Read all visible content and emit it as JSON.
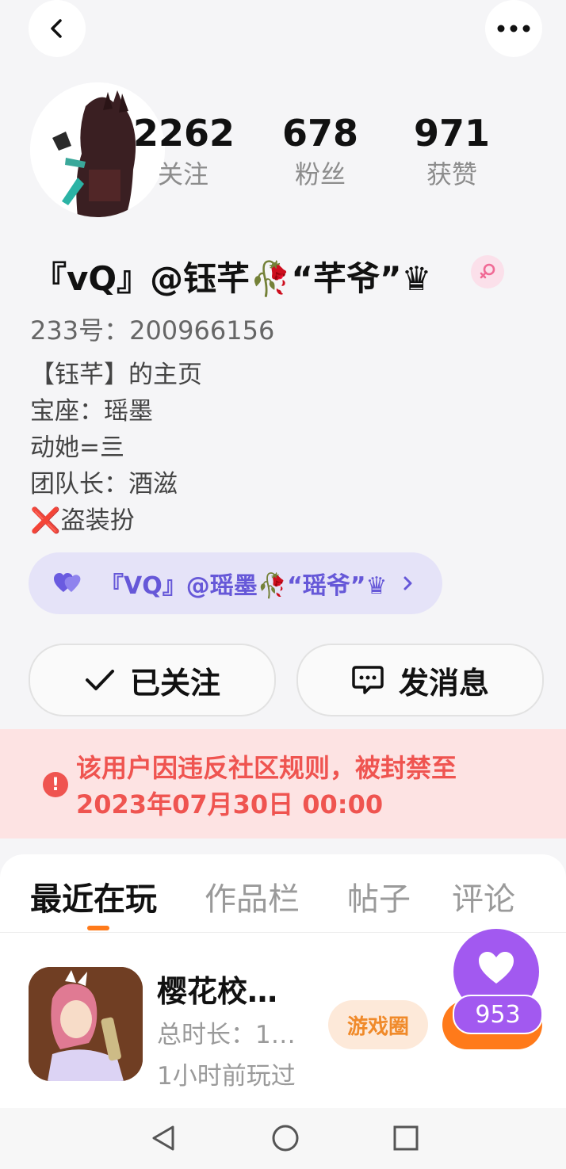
{
  "header": {
    "back_icon": "chevron-left-icon",
    "more_icon": "more-horizontal-icon"
  },
  "profile": {
    "stats": [
      {
        "value": "2262",
        "label": "关注"
      },
      {
        "value": "678",
        "label": "粉丝"
      },
      {
        "value": "971",
        "label": "获赞"
      }
    ],
    "nickname": "『vQ』@钰芊🥀“芊爷”♛",
    "gender_icon": "female-symbol-icon",
    "id_line": "233号：200966156",
    "bio": [
      "【钰芊】的主页",
      "宝座：瑶墨",
      "动她=亖",
      "团队长：酒滋",
      "❌盗装扮"
    ]
  },
  "cp": {
    "label": "『VQ』@瑶墨🥀“瑶爷”♛",
    "icon": "hearts-icon"
  },
  "actions": {
    "follow_label": "已关注",
    "message_label": "发消息"
  },
  "ban": {
    "line1": "该用户因违反社区规则，被封禁至",
    "line2": "2023年07月30日 00:00",
    "color": "#ef5450"
  },
  "tabs": [
    "最近在玩",
    "作品栏",
    "帖子",
    "评论"
  ],
  "game": {
    "title": "樱花校…",
    "duration": "总时长：1…",
    "last_played": "1小时前玩过",
    "circle_button": "游戏圈"
  },
  "like_badge": {
    "count": "953",
    "color": "#a259f0"
  },
  "accent_color": "#ff7a1a"
}
